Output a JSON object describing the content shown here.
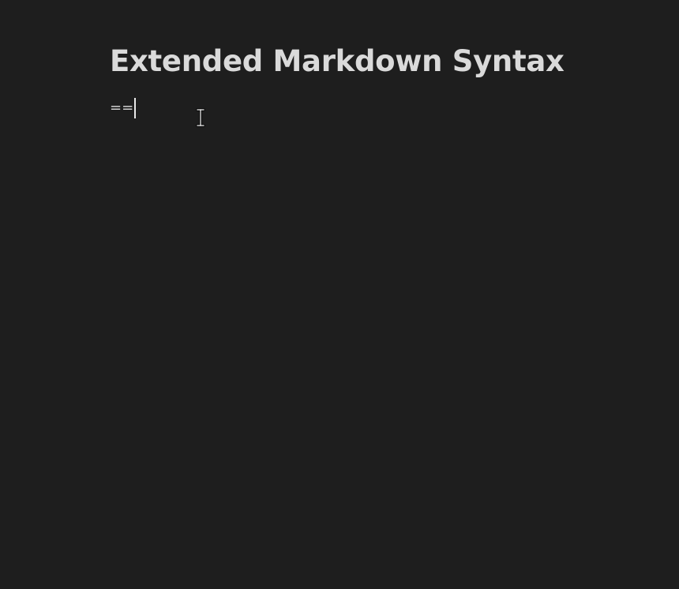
{
  "document": {
    "heading": "Extended Markdown Syntax",
    "current_line": "=="
  },
  "icons": {
    "text_cursor": "text-cursor-ibeam-icon"
  },
  "colors": {
    "background": "#1e1e1e",
    "heading_text": "#dadada",
    "body_text": "#cfcfcf"
  }
}
